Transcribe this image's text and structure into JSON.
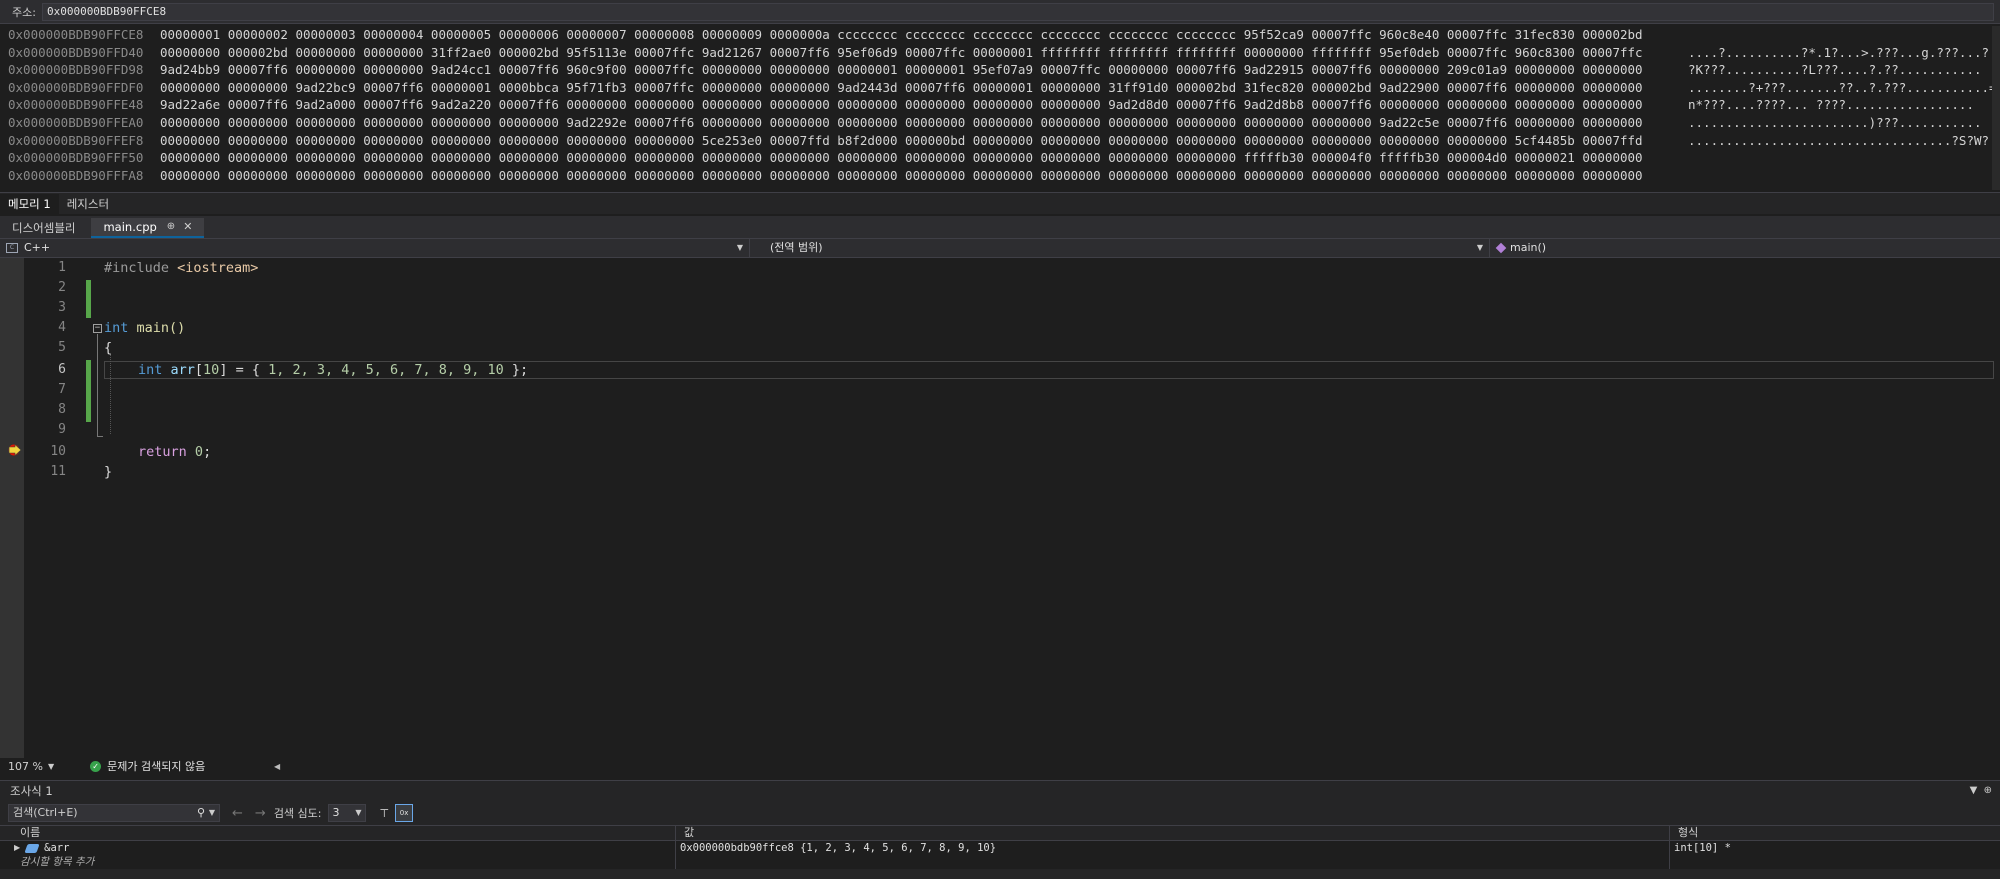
{
  "memory": {
    "address_label": "주소:",
    "address_value": "0x000000BDB90FFCE8",
    "rows": [
      {
        "addr": "0x000000BDB90FFCE8",
        "bytes": "00000001 00000002 00000003 00000004 00000005 00000006 00000007 00000008 00000009 0000000a cccccccc cccccccc cccccccc cccccccc cccccccc cccccccc 95f52ca9 00007ffc 960c8e40 00007ffc 31fec830 000002bd",
        "ascii": ""
      },
      {
        "addr": "0x000000BDB90FFD40",
        "bytes": "00000000 000002bd 00000000 00000000 31ff2ae0 000002bd 95f5113e 00007ffc 9ad21267 00007ff6 95ef06d9 00007ffc 00000001 ffffffff ffffffff ffffffff 00000000 ffffffff 95ef0deb 00007ffc 960c8300 00007ffc",
        "ascii": "....?..........?*.1?...>.???...g.???...?"
      },
      {
        "addr": "0x000000BDB90FFD98",
        "bytes": "9ad24bb9 00007ff6 00000000 00000000 9ad24cc1 00007ff6 960c9f00 00007ffc 00000000 00000000 00000001 00000001 95ef07a9 00007ffc 00000000 00007ff6 9ad22915 00007ff6 00000000 209c01a9 00000000 00000000",
        "ascii": "?K???..........?L???....?.??..........."
      },
      {
        "addr": "0x000000BDB90FFDF0",
        "bytes": "00000000 00000000 9ad22bc9 00007ff6 00000001 0000bbca 95f71fb3 00007ffc 00000000 00000000 9ad2443d 00007ff6 00000001 00000000 31ff91d0 000002bd 31fec820 000002bd 9ad22900 00007ff6 00000000 00000000",
        "ascii": "........?+???.......??..?.???...........="
      },
      {
        "addr": "0x000000BDB90FFE48",
        "bytes": "9ad22a6e 00007ff6 9ad2a000 00007ff6 9ad2a220 00007ff6 00000000 00000000 00000000 00000000 00000000 00000000 00000000 00000000 9ad2d8d0 00007ff6 9ad2d8b8 00007ff6 00000000 00000000 00000000 00000000",
        "ascii": "n*???....????...  ????................."
      },
      {
        "addr": "0x000000BDB90FFEA0",
        "bytes": "00000000 00000000 00000000 00000000 00000000 00000000 9ad2292e 00007ff6 00000000 00000000 00000000 00000000 00000000 00000000 00000000 00000000 00000000 00000000 9ad22c5e 00007ff6 00000000 00000000",
        "ascii": "........................)???..........."
      },
      {
        "addr": "0x000000BDB90FFEF8",
        "bytes": "00000000 00000000 00000000 00000000 00000000 00000000 00000000 00000000 5ce253e0 00007ffd b8f2d000 000000bd 00000000 00000000 00000000 00000000 00000000 00000000 00000000 00000000 5cf4485b 00007ffd",
        "ascii": "...................................?S?W?..."
      },
      {
        "addr": "0x000000BDB90FFF50",
        "bytes": "00000000 00000000 00000000 00000000 00000000 00000000 00000000 00000000 00000000 00000000 00000000 00000000 00000000 00000000 00000000 00000000 fffffb30 000004f0 fffffb30 000004d0 00000021 00000000",
        "ascii": ""
      },
      {
        "addr": "0x000000BDB90FFFA8",
        "bytes": "00000000 00000000 00000000 00000000 00000000 00000000 00000000 00000000 00000000 00000000 00000000 00000000 00000000 00000000 00000000 00000000 00000000 00000000 00000000 00000000 00000000 00000000",
        "ascii": ""
      }
    ],
    "tabs": [
      "메모리 1",
      "레지스터"
    ]
  },
  "editor_tabs": [
    {
      "label": "디스어셈블리"
    },
    {
      "label": "main.cpp",
      "pin": "⊕",
      "close": "✕"
    }
  ],
  "navbar": {
    "project": "C++",
    "scope": "(전역 범위)",
    "function": "main()"
  },
  "code": {
    "line_numbers": [
      "1",
      "2",
      "3",
      "4",
      "5",
      "6",
      "7",
      "8",
      "9",
      "10",
      "11"
    ],
    "line1": {
      "pp": "#include ",
      "inc": "<iostream>"
    },
    "line4": {
      "kw": "int",
      "fn": " main()"
    },
    "line5": "{",
    "line6": {
      "kw": "int",
      "var": " arr",
      "rest1": "[",
      "n10": "10",
      "rest2": "] = { ",
      "nums": "1, 2, 3, 4, 5, 6, 7, 8, 9, 10",
      "rest3": " };"
    },
    "line10": {
      "ctl": "return",
      "sp": " ",
      "num": "0",
      "end": ";"
    },
    "line11": "}"
  },
  "status": {
    "zoom": "107 %",
    "problems": "문제가 검색되지 않음"
  },
  "watch": {
    "title": "조사식 1",
    "search_placeholder": "검색(Ctrl+E)",
    "depth_label": "검색 심도:",
    "depth_value": "3",
    "columns": {
      "name": "이름",
      "value": "값",
      "type": "형식"
    },
    "rows": [
      {
        "name": "&arr",
        "value": "0x000000bdb90ffce8 {1, 2, 3, 4, 5, 6, 7, 8, 9, 10}",
        "type": "int[10] *"
      }
    ],
    "add_item": "감시할 항목 추가"
  }
}
